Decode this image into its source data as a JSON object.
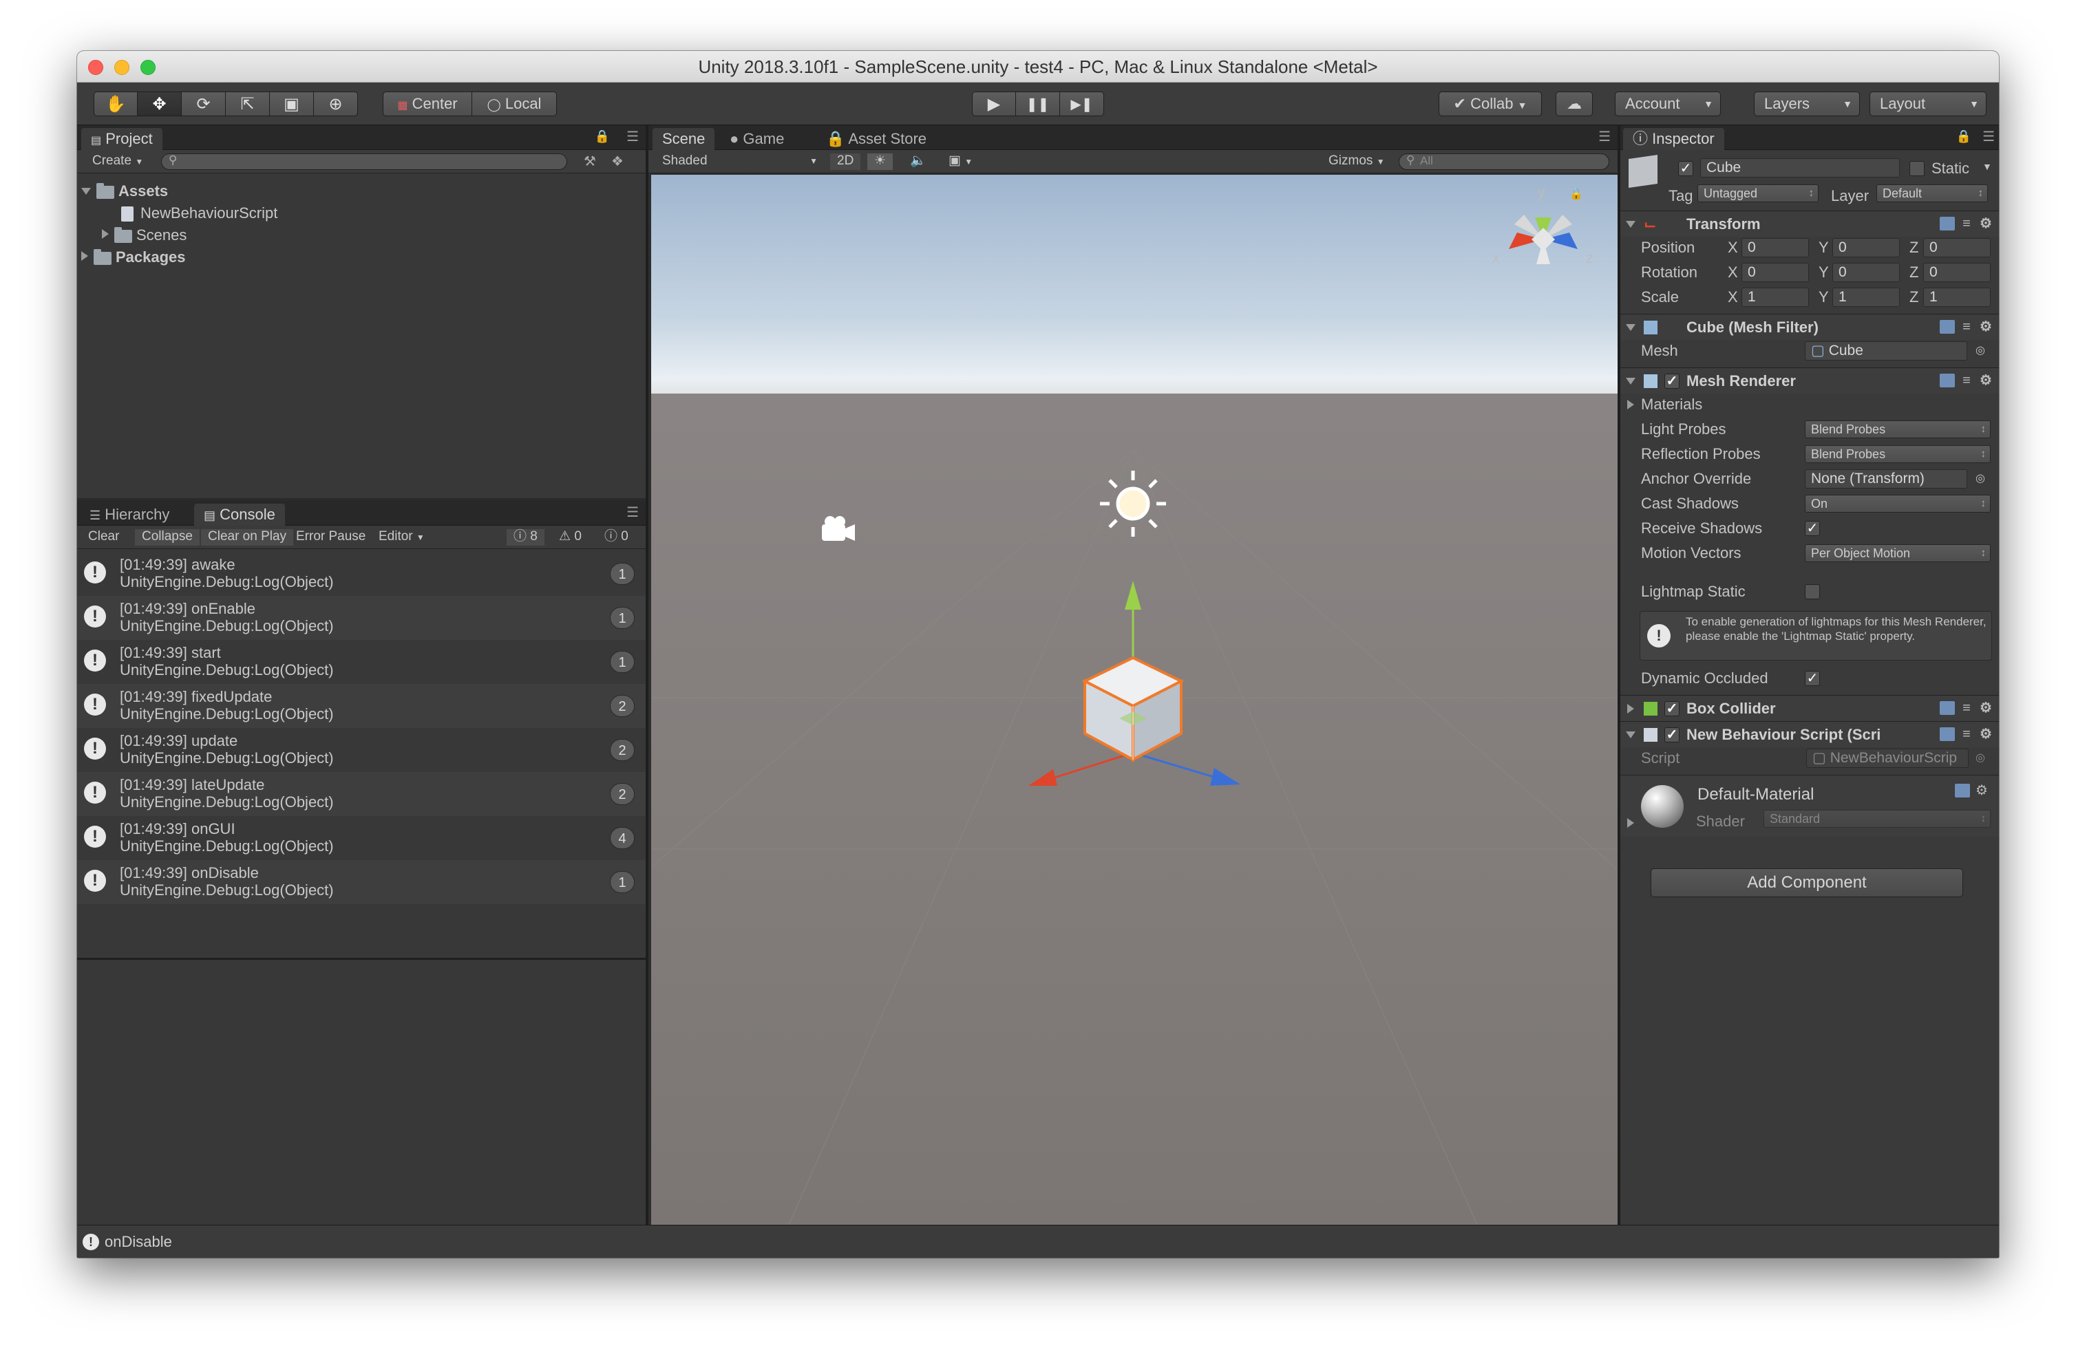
{
  "window": {
    "title": "Unity 2018.3.10f1 - SampleScene.unity - test4 - PC, Mac & Linux Standalone <Metal>"
  },
  "toolbar": {
    "tools": [
      "hand-icon",
      "move-icon",
      "rotate-icon",
      "scale-icon",
      "rect-icon",
      "transform-icon"
    ],
    "pivot": "Center",
    "space": "Local",
    "play": "▶",
    "pause": "❚❚",
    "step": "▶❚",
    "collab": "Collab",
    "account": "Account",
    "layers": "Layers",
    "layout": "Layout"
  },
  "project": {
    "tab": "Project",
    "create": "Create",
    "tree": [
      {
        "label": "Assets",
        "bold": true
      },
      {
        "label": "NewBehaviourScript"
      },
      {
        "label": "Scenes"
      },
      {
        "label": "Packages",
        "bold": true
      }
    ]
  },
  "console": {
    "tabs": [
      "Hierarchy",
      "Console"
    ],
    "buttons": [
      "Clear",
      "Collapse",
      "Clear on Play",
      "Error Pause",
      "Editor"
    ],
    "counts": {
      "info": "8",
      "warn": "0",
      "error": "0"
    },
    "logs": [
      {
        "line1": "[01:49:39] awake",
        "line2": "UnityEngine.Debug:Log(Object)",
        "count": "1"
      },
      {
        "line1": "[01:49:39] onEnable",
        "line2": "UnityEngine.Debug:Log(Object)",
        "count": "1"
      },
      {
        "line1": "[01:49:39] start",
        "line2": "UnityEngine.Debug:Log(Object)",
        "count": "1"
      },
      {
        "line1": "[01:49:39] fixedUpdate",
        "line2": "UnityEngine.Debug:Log(Object)",
        "count": "2"
      },
      {
        "line1": "[01:49:39] update",
        "line2": "UnityEngine.Debug:Log(Object)",
        "count": "2"
      },
      {
        "line1": "[01:49:39] lateUpdate",
        "line2": "UnityEngine.Debug:Log(Object)",
        "count": "2"
      },
      {
        "line1": "[01:49:39] onGUI",
        "line2": "UnityEngine.Debug:Log(Object)",
        "count": "4"
      },
      {
        "line1": "[01:49:39] onDisable",
        "line2": "UnityEngine.Debug:Log(Object)",
        "count": "1"
      }
    ]
  },
  "scene": {
    "tabs": [
      "Scene",
      "Game",
      "Asset Store"
    ],
    "shading": "Shaded",
    "mode2d": "2D",
    "gizmos": "Gizmos",
    "search_placeholder": "All",
    "gizmo_axes": {
      "y": "y",
      "x": "x",
      "z": "z"
    }
  },
  "inspector": {
    "tab": "Inspector",
    "object_name": "Cube",
    "static_label": "Static",
    "tag_label": "Tag",
    "tag_value": "Untagged",
    "layer_label": "Layer",
    "layer_value": "Default",
    "transform": {
      "title": "Transform",
      "rows": [
        {
          "label": "Position",
          "x": "0",
          "y": "0",
          "z": "0"
        },
        {
          "label": "Rotation",
          "x": "0",
          "y": "0",
          "z": "0"
        },
        {
          "label": "Scale",
          "x": "1",
          "y": "1",
          "z": "1"
        }
      ]
    },
    "mesh_filter": {
      "title": "Cube (Mesh Filter)",
      "mesh_label": "Mesh",
      "mesh_value": "Cube"
    },
    "mesh_renderer": {
      "title": "Mesh Renderer",
      "materials": "Materials",
      "light_probes_label": "Light Probes",
      "light_probes": "Blend Probes",
      "reflection_probes_label": "Reflection Probes",
      "reflection_probes": "Blend Probes",
      "anchor_override_label": "Anchor Override",
      "anchor_override": "None (Transform)",
      "cast_shadows_label": "Cast Shadows",
      "cast_shadows": "On",
      "receive_shadows_label": "Receive Shadows",
      "motion_vectors_label": "Motion Vectors",
      "motion_vectors": "Per Object Motion",
      "lightmap_static_label": "Lightmap Static",
      "info": "To enable generation of lightmaps for this Mesh Renderer, please enable the 'Lightmap Static' property.",
      "dynamic_occluded_label": "Dynamic Occluded"
    },
    "box_collider": {
      "title": "Box Collider"
    },
    "script_comp": {
      "title": "New Behaviour Script (Scri",
      "script_label": "Script",
      "script_value": "NewBehaviourScrip"
    },
    "material": {
      "name": "Default-Material",
      "shader_label": "Shader",
      "shader_value": "Standard"
    },
    "add_component": "Add Component"
  },
  "statusbar": {
    "text": "onDisable"
  },
  "colors": {
    "accent_blue": "#3d6fa8",
    "orange": "#f07a2a",
    "green": "#9ad04a",
    "red": "#e0442a",
    "blue": "#3a6fd8"
  }
}
